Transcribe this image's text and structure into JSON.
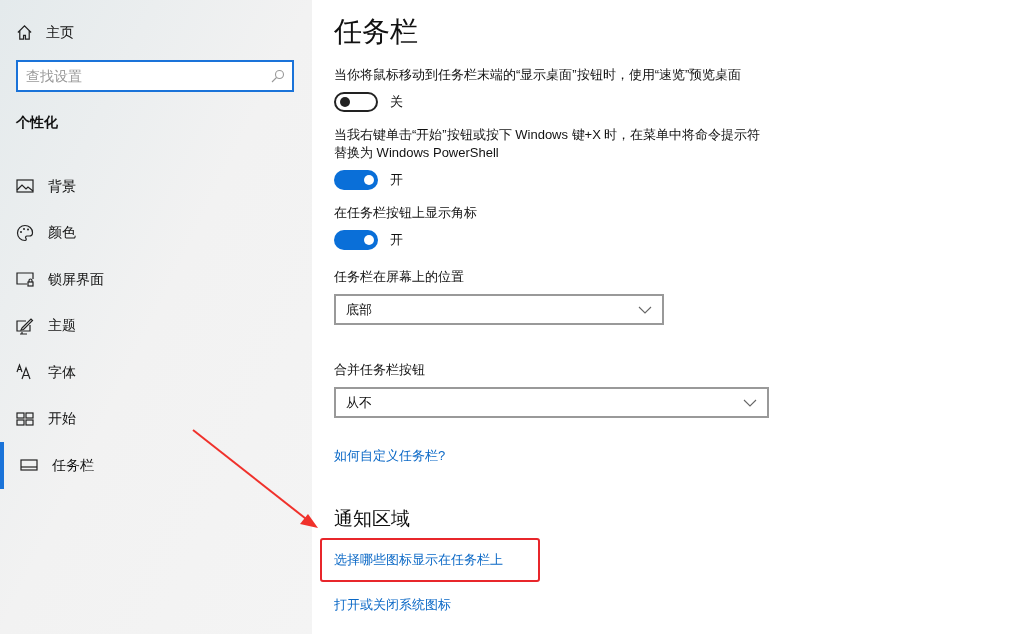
{
  "sidebar": {
    "home": "主页",
    "search": {
      "placeholder": "查找设置"
    },
    "section": "个性化",
    "items": [
      {
        "label": "背景",
        "selected": false
      },
      {
        "label": "颜色",
        "selected": false
      },
      {
        "label": "锁屏界面",
        "selected": false
      },
      {
        "label": "主题",
        "selected": false
      },
      {
        "label": "字体",
        "selected": false
      },
      {
        "label": "开始",
        "selected": false
      },
      {
        "label": "任务栏",
        "selected": true
      }
    ]
  },
  "main": {
    "title": "任务栏",
    "settings": [
      {
        "kind": "toggle",
        "label": "当你将鼠标移动到任务栏末端的“显示桌面”按钮时，使用“速览”预览桌面",
        "on": false,
        "state_label": "关"
      },
      {
        "kind": "toggle",
        "label": "当我右键单击“开始”按钮或按下 Windows 键+X 时，在菜单中将命令提示符替换为 Windows PowerShell",
        "on": true,
        "state_label": "开"
      },
      {
        "kind": "toggle",
        "label": "在任务栏按钮上显示角标",
        "on": true,
        "state_label": "开"
      },
      {
        "kind": "dropdown",
        "label": "任务栏在屏幕上的位置",
        "value": "底部"
      },
      {
        "kind": "dropdown",
        "label": "合并任务栏按钮",
        "value": "从不"
      }
    ],
    "help_link": "如何自定义任务栏?",
    "notification": {
      "heading": "通知区域",
      "links": [
        {
          "text": "选择哪些图标显示在任务栏上",
          "highlighted": true
        },
        {
          "text": "打开或关闭系统图标",
          "highlighted": false
        }
      ]
    }
  }
}
